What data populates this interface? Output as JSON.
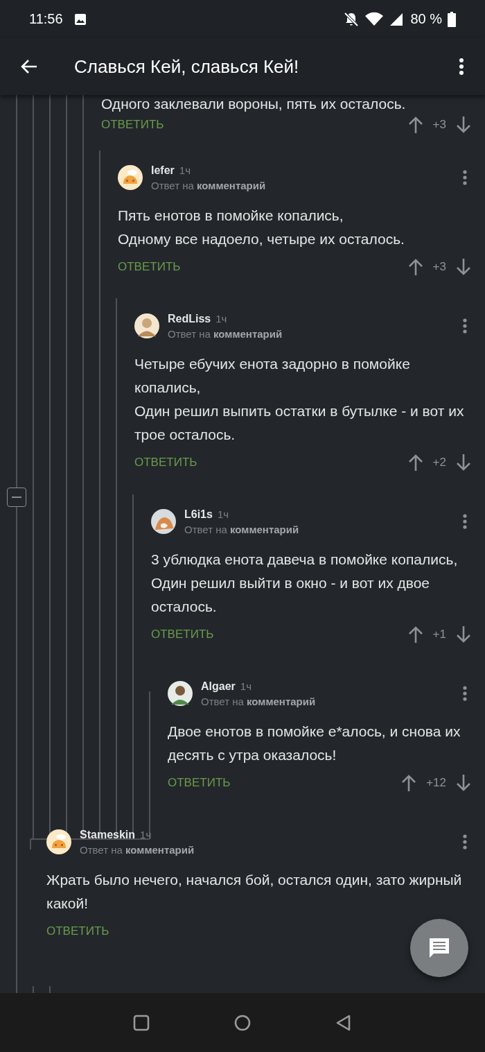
{
  "status_bar": {
    "time": "11:56",
    "battery": "80 %"
  },
  "app_bar": {
    "title": "Славься Кей, славься Кей!"
  },
  "thread": {
    "expanded": true
  },
  "comments": [
    {
      "kind": "partial",
      "text": "Одного заклевали вороны, пять их осталось.",
      "reply": "ОТВЕТИТЬ",
      "score": "+3",
      "children": [
        {
          "kind": "comment",
          "author": "Iefer",
          "time": "1ч",
          "avatar": {
            "kind": "cartoon"
          },
          "reply_to": "Ответ на **комментарий**",
          "text": "Пять енотов в помойке копались,\nОдному все надоело, четыре их осталось.",
          "reply": "ОТВЕТИТЬ",
          "score": "+3",
          "children": [
            {
              "kind": "comment",
              "author": "RedLiss",
              "time": "1ч",
              "avatar": {
                "kind": "sketch"
              },
              "reply_to": "Ответ на **комментарий**",
              "text": "Четыре ебучих енота задорно в помойке копались,\nОдин решил выпить остатки в бутылке - и вот их трое осталось.",
              "reply": "ОТВЕТИТЬ",
              "score": "+2",
              "children": [
                {
                  "kind": "comment",
                  "author": "L6i1s",
                  "time": "1ч",
                  "avatar": {
                    "kind": "animal"
                  },
                  "reply_to": "Ответ на **комментарий**",
                  "text": "3 ублюдка енота давеча в помойке копались,\nОдин решил выйти в окно - и вот их двое осталось.",
                  "reply": "ОТВЕТИТЬ",
                  "score": "+1",
                  "children": [
                    {
                      "kind": "comment",
                      "author": "Algaer",
                      "time": "1ч",
                      "avatar": {
                        "kind": "person"
                      },
                      "reply_to": "Ответ на **комментарий**",
                      "text": "Двое енотов в помойке е*алось, и снова их десять с утра оказалось!",
                      "reply": "ОТВЕТИТЬ",
                      "score": "+12"
                    }
                  ]
                }
              ]
            }
          ]
        }
      ]
    },
    {
      "kind": "comment",
      "author": "Stameskin",
      "time": "1ч",
      "avatar": {
        "kind": "cartoon"
      },
      "reply_to": "Ответ на **комментарий**",
      "text": "Жрать было нечего, начался бой, остался один, зато жирный какой!",
      "reply": "ОТВЕТИТЬ"
    }
  ]
}
